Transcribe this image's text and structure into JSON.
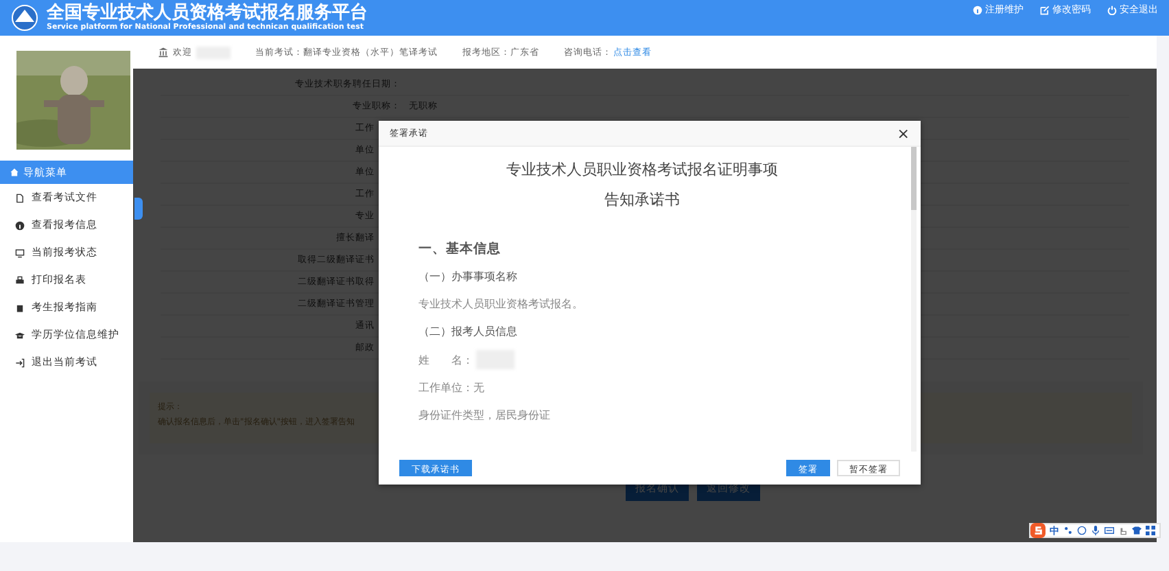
{
  "header": {
    "title": "全国专业技术人员资格考试报名服务平台",
    "subtitle": "Service platform for National Professional and technican qualification test",
    "links": [
      {
        "kind": "info",
        "label": "注册维护"
      },
      {
        "kind": "edit",
        "label": "修改密码"
      },
      {
        "kind": "power",
        "label": "安全退出"
      }
    ]
  },
  "avatar": {
    "kind": "picture"
  },
  "nav": {
    "title": "导航菜单",
    "items": [
      {
        "kind": "file",
        "label": "查看考试文件"
      },
      {
        "kind": "info",
        "label": "查看报考信息"
      },
      {
        "kind": "monitor",
        "label": "当前报考状态"
      },
      {
        "kind": "print",
        "label": "打印报名表"
      },
      {
        "kind": "book",
        "label": "考生报考指南"
      },
      {
        "kind": "cap",
        "label": "学历学位信息维护"
      },
      {
        "kind": "exit",
        "label": "退出当前考试"
      }
    ]
  },
  "info_bar": {
    "welcome": "欢迎",
    "exam_label": "当前考试：",
    "exam": "翻译专业资格（水平）笔译考试",
    "region_label": "报考地区：",
    "region": "广东省",
    "phone_label": "咨询电话：",
    "phone_link": "点击查看"
  },
  "form_rows": [
    {
      "label": "专业技术职务聘任日期：",
      "cut": false
    },
    {
      "label": "专业职称：",
      "value": "无职称",
      "cut": false
    },
    {
      "label": "工作",
      "cut": true
    },
    {
      "label": "单位",
      "cut": true
    },
    {
      "label": "单位",
      "cut": true
    },
    {
      "label": "工作",
      "cut": true
    },
    {
      "label": "专业",
      "cut": true
    },
    {
      "label": "擅长翻译",
      "cut": true
    },
    {
      "label": "取得二级翻译证书",
      "cut": true
    },
    {
      "label": "二级翻译证书取得",
      "cut": true
    },
    {
      "label": "二级翻译证书管理",
      "cut": true
    },
    {
      "label": "通讯",
      "cut": true
    },
    {
      "label": "邮政",
      "cut": true
    }
  ],
  "tip": {
    "title": "提示：",
    "text": "确认报名信息后，单击\"报名确认\"按钮，进入签署告知"
  },
  "page_buttons": [
    "报名确认",
    "返回修改"
  ],
  "dialog": {
    "title": "签署承诺",
    "close": "×",
    "heading": [
      "专业技术人员职业资格考试报名证明事项",
      "告知承诺书"
    ],
    "blocks": [
      {
        "kind": "section",
        "text": "一、基本信息"
      },
      {
        "kind": "subsection",
        "text": "（一）办事事项名称"
      },
      {
        "kind": "body",
        "text": "专业技术人员职业资格考试报名。"
      },
      {
        "kind": "subsection",
        "text": "（二）报考人员信息"
      },
      {
        "kind": "field",
        "text": "姓　　名："
      },
      {
        "kind": "body",
        "text": "工作单位：无"
      },
      {
        "kind": "body",
        "text": "身份证件类型，居民身份证"
      }
    ],
    "download": "下载承诺书",
    "sign": "签署",
    "decline": "暂不签署"
  },
  "ime": {
    "label": "中"
  }
}
